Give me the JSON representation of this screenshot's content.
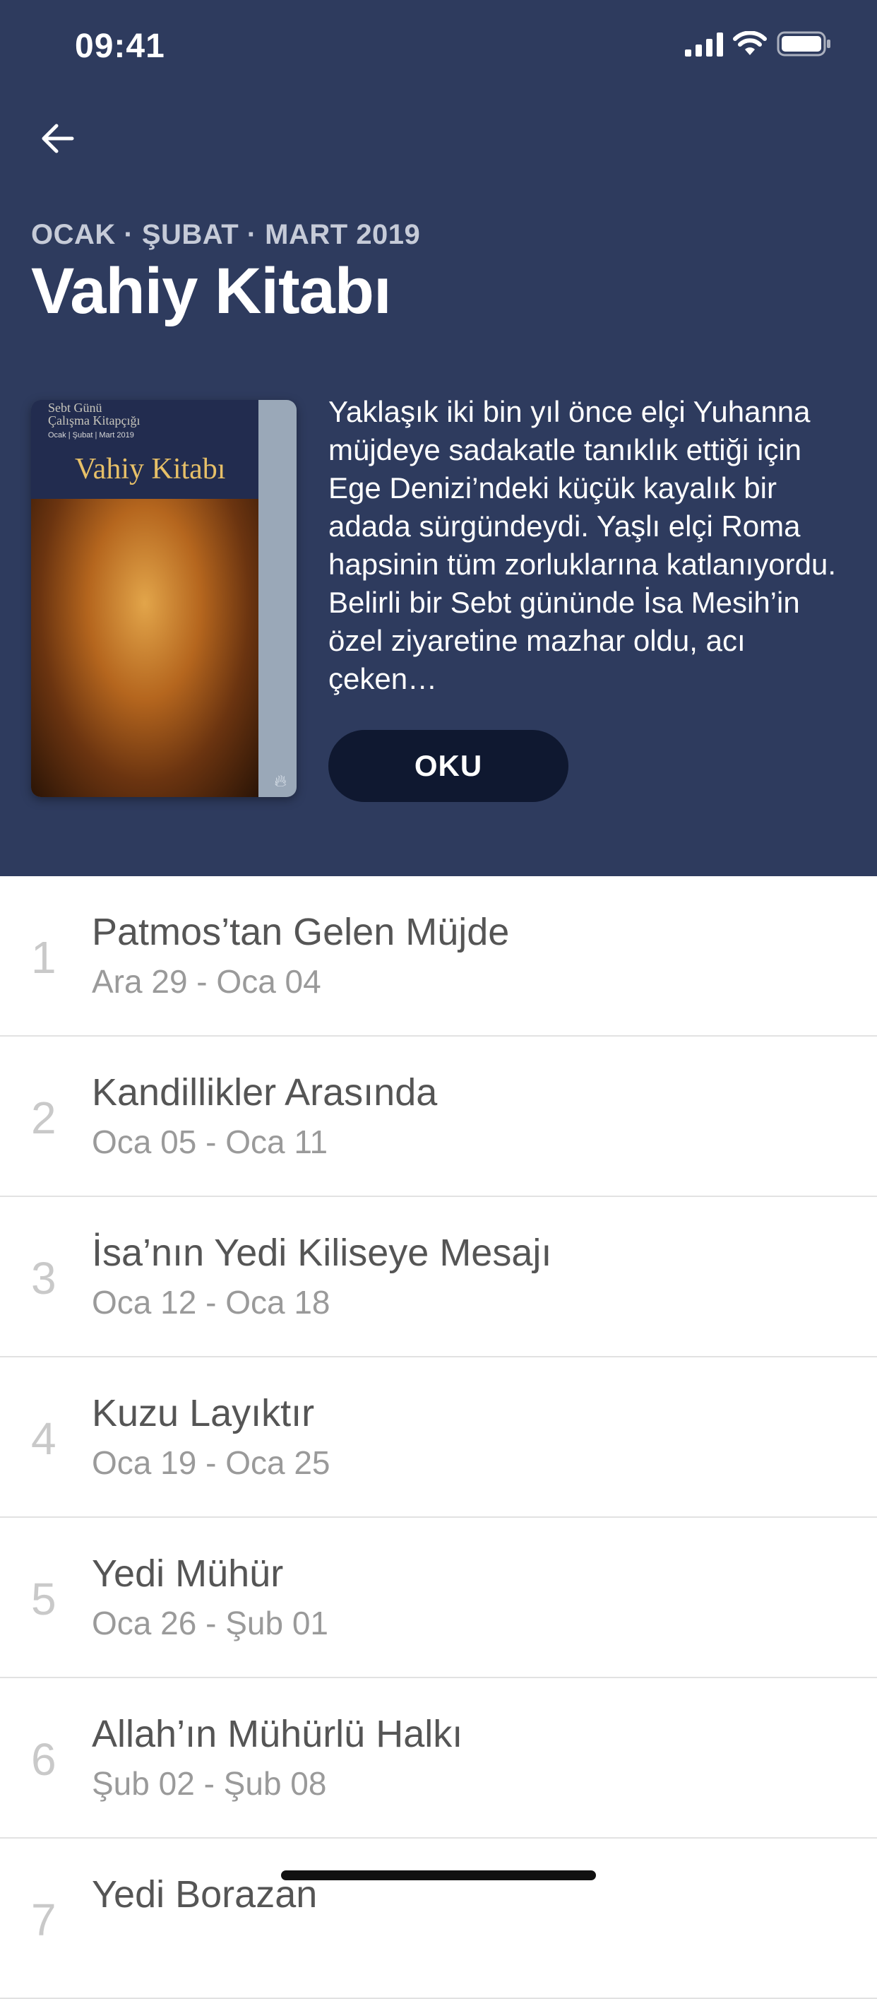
{
  "status_bar": {
    "time": "09:41"
  },
  "header": {
    "quarter": "OCAK · ŞUBAT · MART 2019",
    "title": "Vahiy Kitabı",
    "cover": {
      "publisher_line1": "Sebt Günü",
      "publisher_line2": "Çalışma Kitapçığı",
      "date": "Ocak | Şubat | Mart 2019",
      "title": "Vahiy Kitabı"
    },
    "description": "Yaklaşık iki bin yıl önce elçi Yuhanna müjdeye sadakatle tanıklık ettiği için Ege Denizi’ndeki küçük kayalık bir adada sürgündeydi. Yaşlı elçi Roma hapsinin tüm zorluklarına katlanıyordu. Belirli bir Sebt gününde İsa Mesih’in özel ziyaretine mazhar oldu, acı çeken…",
    "read_button": "OKU"
  },
  "lessons": [
    {
      "number": "1",
      "title": "Patmos’tan Gelen Müjde",
      "dates": "Ara 29 - Oca 04"
    },
    {
      "number": "2",
      "title": "Kandillikler Arasında",
      "dates": "Oca 05 - Oca 11"
    },
    {
      "number": "3",
      "title": "İsa’nın Yedi Kiliseye Mesajı",
      "dates": "Oca 12 - Oca 18"
    },
    {
      "number": "4",
      "title": "Kuzu Layıktır",
      "dates": "Oca 19 - Oca 25"
    },
    {
      "number": "5",
      "title": "Yedi Mühür",
      "dates": "Oca 26 - Şub 01"
    },
    {
      "number": "6",
      "title": "Allah’ın Mühürlü Halkı",
      "dates": "Şub 02 - Şub 08"
    },
    {
      "number": "7",
      "title": "Yedi Borazan",
      "dates": ""
    }
  ],
  "colors": {
    "header_bg": "#2e3b5e",
    "button_bg": "#0f1830"
  },
  "icons": {
    "back": "arrow-left-icon",
    "signal": "cellular-signal-icon",
    "wifi": "wifi-icon",
    "battery": "battery-icon"
  }
}
